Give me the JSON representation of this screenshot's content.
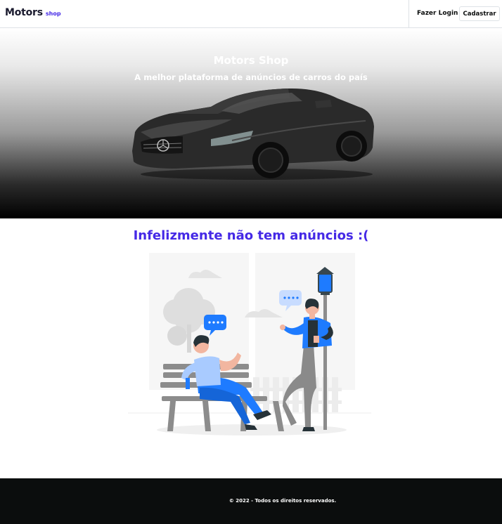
{
  "header": {
    "brand_main": "Motors",
    "brand_sub": "shop",
    "login_label": "Fazer Login",
    "signup_label": "Cadastrar"
  },
  "hero": {
    "title": "Motors Shop",
    "subtitle": "A melhor plataforma de anúncios de carros do país"
  },
  "empty_state": {
    "message": "Infelizmente não tem anúncios :("
  },
  "footer": {
    "copyright": "© 2022 - Todos os direitos reservados."
  },
  "colors": {
    "brand": "#4529e6",
    "footer_bg": "#0b0d0d",
    "illustration_blue": "#1e7bff"
  }
}
